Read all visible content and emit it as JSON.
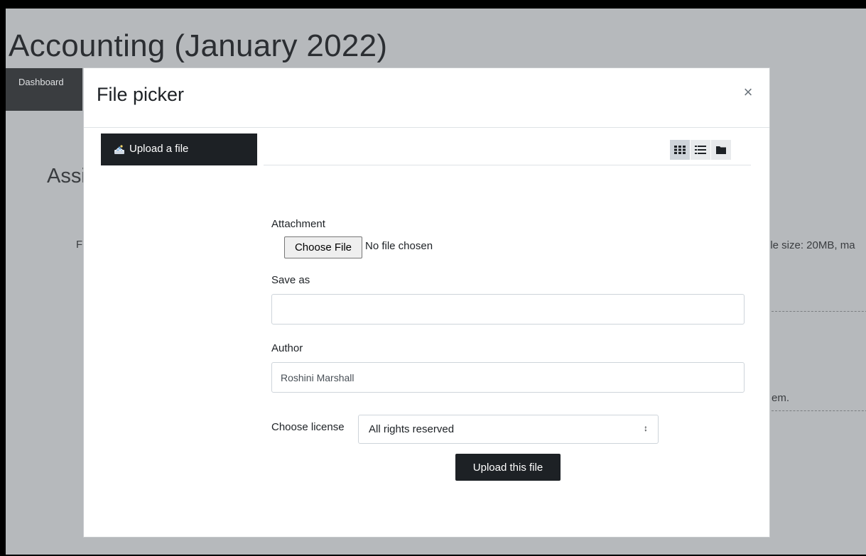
{
  "background": {
    "course_title": "Accounting (January 2022)",
    "nav_item": "Dashboard",
    "section_heading": "Assi",
    "left_fragment": "F",
    "file_size_fragment": "ile size: 20MB, ma",
    "trailing_fragment": "em."
  },
  "modal": {
    "title": "File picker",
    "close_label": "×",
    "repositories": [
      {
        "label": "Upload a file",
        "icon": "upload-icon"
      }
    ],
    "view_buttons": [
      {
        "icon": "grid-icon",
        "active": true
      },
      {
        "icon": "list-icon",
        "active": false
      },
      {
        "icon": "folder-icon",
        "active": false
      }
    ],
    "form": {
      "attachment_label": "Attachment",
      "choose_file_label": "Choose File",
      "file_status": "No file chosen",
      "save_as_label": "Save as",
      "save_as_value": "",
      "author_label": "Author",
      "author_value": "Roshini Marshall",
      "license_label": "Choose license",
      "license_value": "All rights reserved",
      "upload_button": "Upload this file"
    }
  }
}
